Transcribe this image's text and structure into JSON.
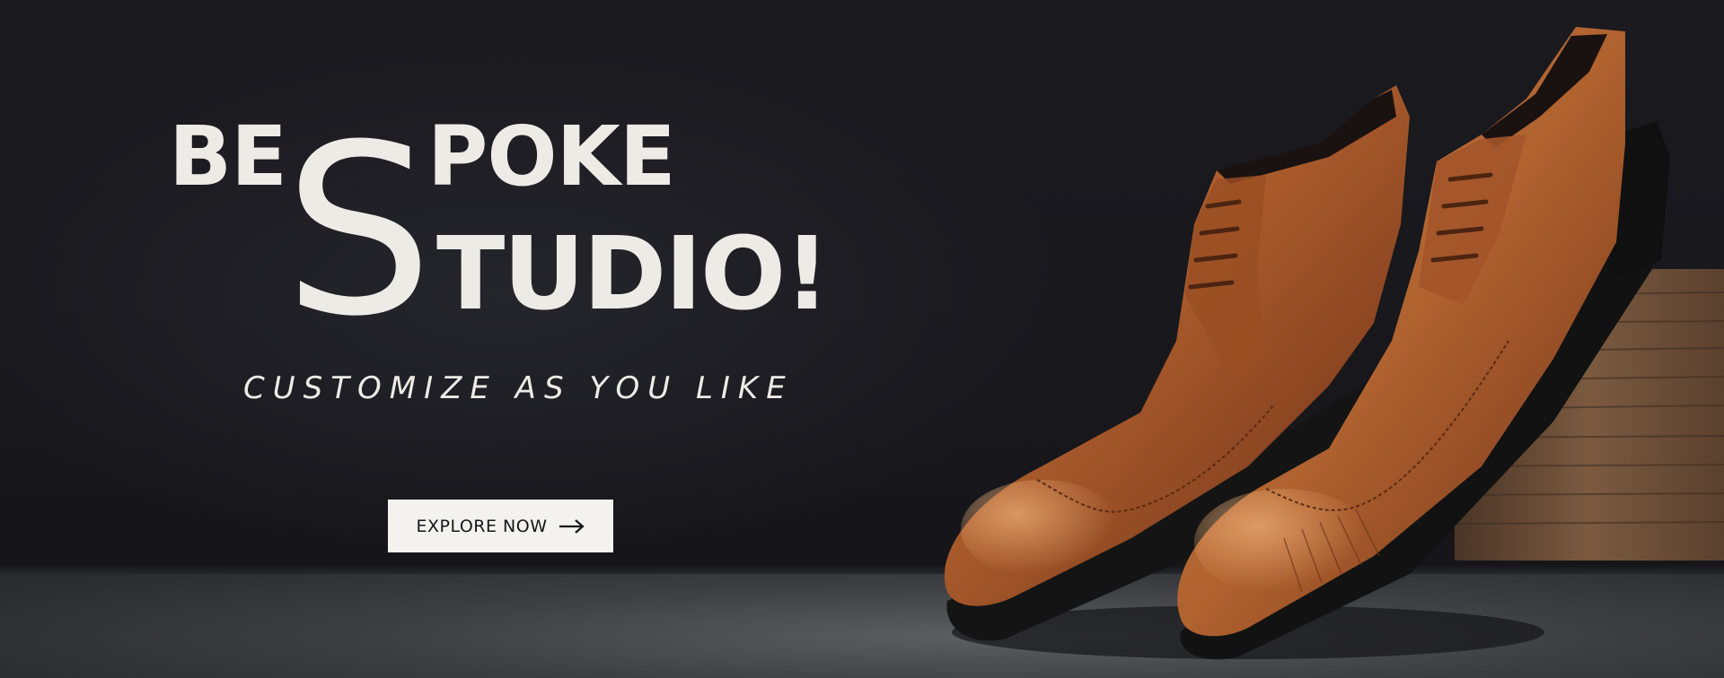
{
  "hero": {
    "headline_line1": "BESPOKE",
    "headline_line1_before": "BE",
    "headline_line1_after": "POKE",
    "headline_big_letter": "S",
    "headline_line2_after": "TUDIO!",
    "tagline": "CUSTOMIZE AS YOU LIKE",
    "cta_label": "EXPLORE NOW",
    "cta_icon": "arrow-right-icon"
  },
  "product_image": {
    "subject": "shoes-image"
  },
  "colors": {
    "background": "#17171c",
    "headline": "#ecebe6",
    "button_bg": "#f3f2ee",
    "button_text": "#16161b",
    "leather": "#a6582a"
  }
}
